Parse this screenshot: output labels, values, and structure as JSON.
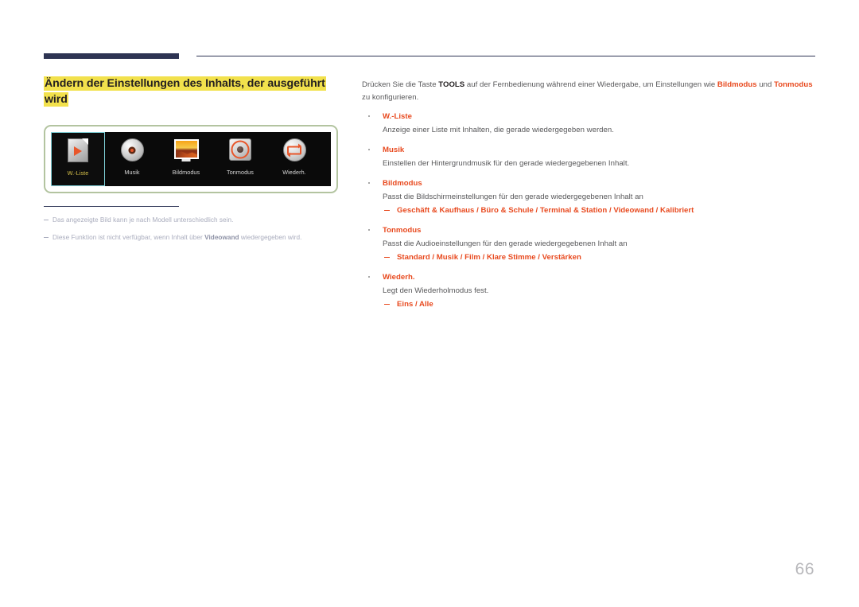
{
  "document": {
    "page_number": "66"
  },
  "title": {
    "line1": "Ändern der Einstellungen des Inhalts, der ausgeführt",
    "line2": "wird",
    "highlight_color": "#f2e14c"
  },
  "figure": {
    "name": "tv-tools-menu-bar",
    "items": [
      {
        "label": "W.-Liste",
        "icon": "file-play-icon",
        "selected": true
      },
      {
        "label": "Musik",
        "icon": "disc-icon",
        "selected": false
      },
      {
        "label": "Bildmodus",
        "icon": "monitor-icon",
        "selected": false
      },
      {
        "label": "Tonmodus",
        "icon": "speaker-icon",
        "selected": false
      },
      {
        "label": "Wiederh.",
        "icon": "repeat-icon",
        "selected": false
      }
    ],
    "border_color": "#b3c4a0",
    "background_color": "#0a0a0a",
    "selected_outline_color": "#7fd0d8",
    "selected_label_color": "#d8c24a"
  },
  "notes": [
    {
      "pre": "Das angezeigte Bild kann je nach Modell unterschiedlich sein.",
      "bold": "",
      "post": ""
    },
    {
      "pre": "Diese Funktion ist nicht verfügbar, wenn Inhalt über ",
      "bold": "Videowand",
      "post": " wiedergegeben wird."
    }
  ],
  "intro": {
    "p1": "Drücken Sie die Taste ",
    "kw1": "TOOLS",
    "p2": " auf der Fernbedienung während einer Wiedergabe, um Einstellungen wie ",
    "ac1": "Bildmodus",
    "p3": " und ",
    "ac2": "Tonmodus",
    "p4": " zu konfigurieren."
  },
  "list": [
    {
      "term": "W.-Liste",
      "desc": "Anzeige einer Liste mit Inhalten, die gerade wiedergegeben werden.",
      "options": ""
    },
    {
      "term": "Musik",
      "desc": "Einstellen der Hintergrundmusik für den gerade wiedergegebenen Inhalt.",
      "options": ""
    },
    {
      "term": "Bildmodus",
      "desc": "Passt die Bildschirmeinstellungen für den gerade wiedergegebenen Inhalt an",
      "options": "Geschäft & Kaufhaus / Büro & Schule / Terminal & Station / Videowand / Kalibriert"
    },
    {
      "term": "Tonmodus",
      "desc": "Passt die Audioeinstellungen für den gerade wiedergegebenen Inhalt an",
      "options": "Standard / Musik / Film / Klare Stimme / Verstärken"
    },
    {
      "term": "Wiederh.",
      "desc": "Legt den Wiederholmodus fest.",
      "options": "Eins / Alle"
    }
  ],
  "colors": {
    "accent": "#e8491e",
    "header_rule": "#2e3453",
    "body_text": "#58585a",
    "note_text": "#a9acbd",
    "page_number": "#b8b8bb"
  }
}
